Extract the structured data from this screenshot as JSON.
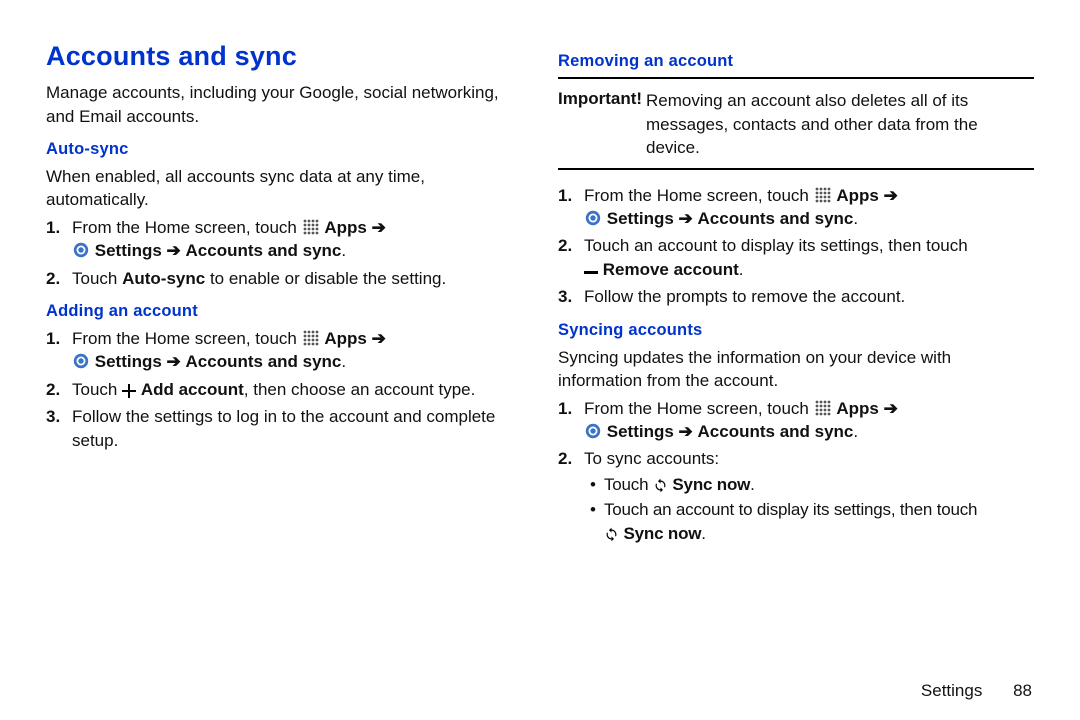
{
  "title": "Accounts and sync",
  "intro": "Manage accounts, including your Google, social networking, and Email accounts.",
  "auto_sync": {
    "heading": "Auto-sync",
    "desc": "When enabled, all accounts sync data at any time, automatically.",
    "step1_a": "From the Home screen, touch ",
    "apps_label": "Apps",
    "arrow": "➔",
    "settings_label": "Settings",
    "accounts_label": "Accounts and sync",
    "step2_a": "Touch ",
    "step2_b": "Auto-sync",
    "step2_c": " to enable or disable the setting."
  },
  "adding": {
    "heading": "Adding an account",
    "step2": "Touch ",
    "add_account": "Add account",
    "step2_b": ", then choose an account type.",
    "step3": "Follow the settings to log in to the account and complete setup."
  },
  "removing": {
    "heading": "Removing an account",
    "important_label": "Important!",
    "important_body": "Removing an account also deletes all of its messages, contacts and other data from the device.",
    "step2": "Touch an account to display its settings, then touch ",
    "remove_account": "Remove account",
    "step3": "Follow the prompts to remove the account."
  },
  "syncing": {
    "heading": "Syncing accounts",
    "desc": "Syncing updates the information on your device with information from the account.",
    "to_sync": "To sync accounts:",
    "touch": "Touch ",
    "sync_now": "Sync now",
    "bullet2": "Touch an account to display its settings, then touch "
  },
  "footer": {
    "section": "Settings",
    "page": "88"
  }
}
